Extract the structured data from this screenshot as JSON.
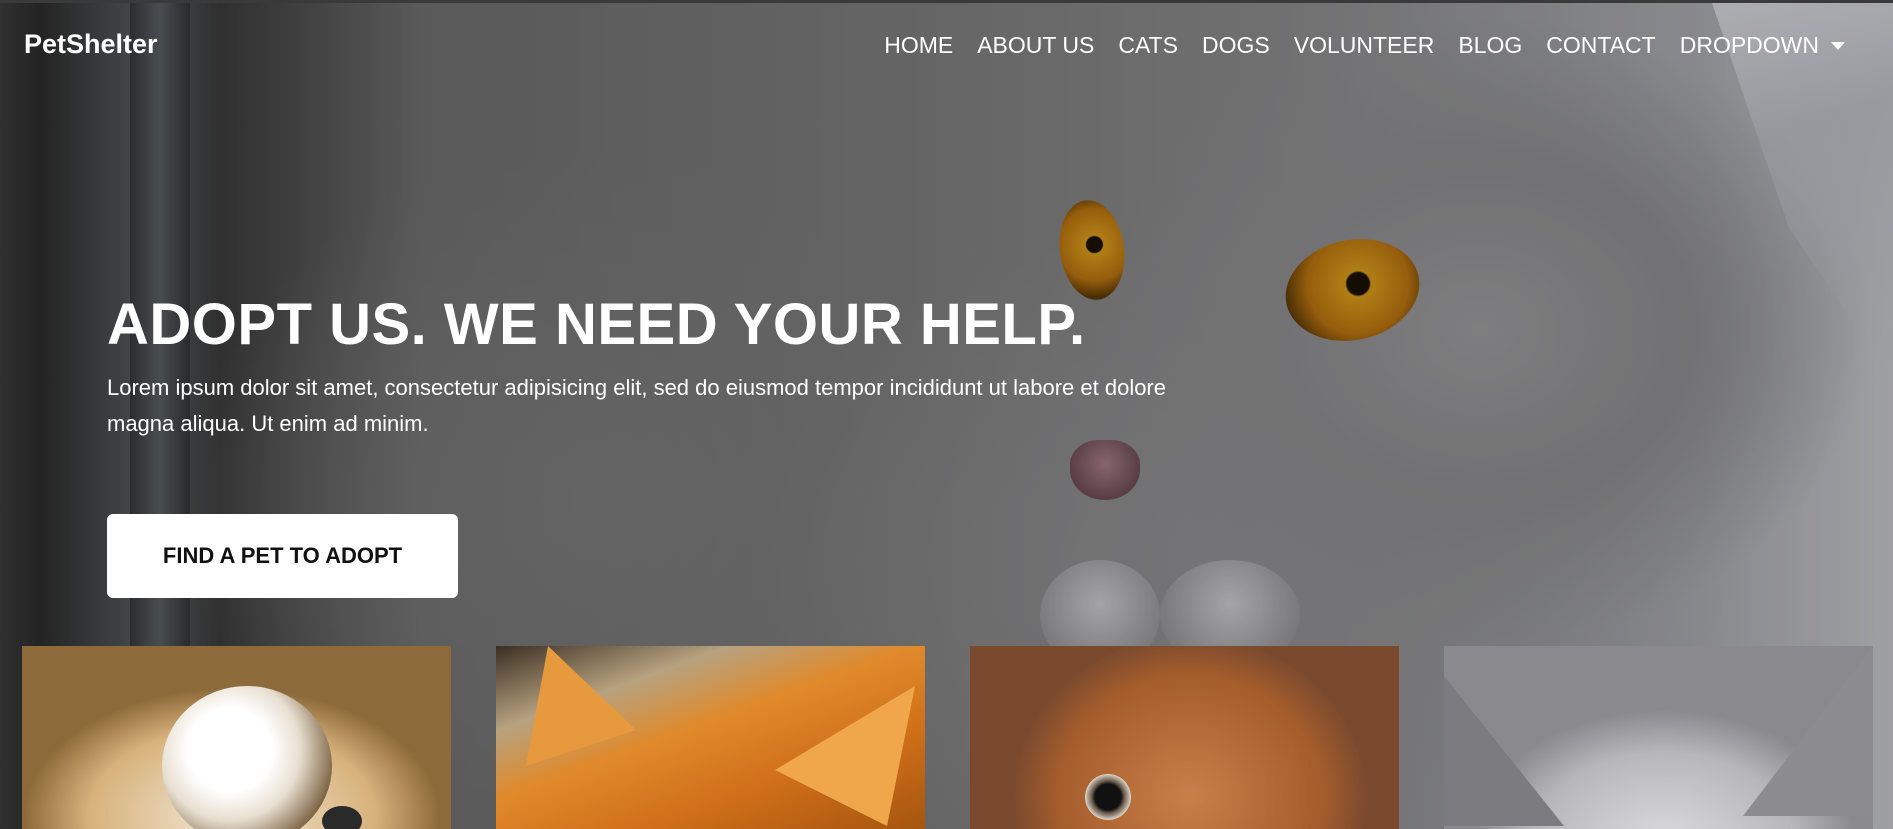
{
  "brand": "PetShelter",
  "nav": {
    "items": [
      "HOME",
      "ABOUT US",
      "CATS",
      "DOGS",
      "VOLUNTEER",
      "BLOG",
      "CONTACT"
    ],
    "dropdown_label": "DROPDOWN"
  },
  "hero": {
    "title": "ADOPT US. WE NEED YOUR HELP.",
    "text": "Lorem ipsum dolor sit amet, consectetur adipisicing elit, sed do eiusmod tempor incididunt ut labore et dolore magna aliqua. Ut enim ad minim.",
    "cta_label": "FIND A PET TO ADOPT"
  },
  "thumbnails": [
    {
      "subject": "puppy"
    },
    {
      "subject": "orange-cat"
    },
    {
      "subject": "dog"
    },
    {
      "subject": "gray-cat"
    }
  ],
  "colors": {
    "text": "#ffffff",
    "button_bg": "#ffffff",
    "button_text": "#111111"
  }
}
